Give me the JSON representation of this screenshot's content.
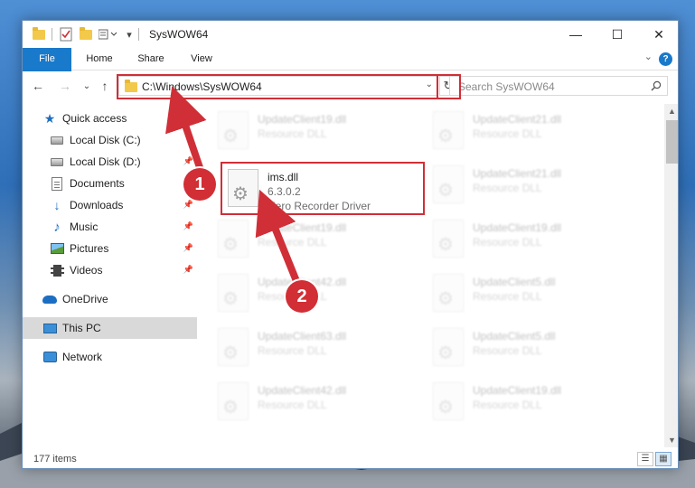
{
  "window": {
    "title": "SysWOW64",
    "minimize_glyph": "—",
    "maximize_glyph": "☐",
    "close_glyph": "✕"
  },
  "ribbon": {
    "tabs": [
      "File",
      "Home",
      "Share",
      "View"
    ],
    "help_glyph": "?",
    "collapse_glyph": "⌄"
  },
  "nav": {
    "back_glyph": "←",
    "forward_glyph": "→",
    "recent_glyph": "⌄",
    "up_glyph": "↑",
    "address": "C:\\Windows\\SysWOW64",
    "address_dropdown_glyph": "⌄",
    "refresh_glyph": "↻",
    "search_placeholder": "Search SysWOW64"
  },
  "sidebar": {
    "items": [
      {
        "label": "Quick access",
        "icon": "star-icon"
      },
      {
        "label": "Local Disk (C:)",
        "icon": "drive-icon"
      },
      {
        "label": "Local Disk (D:)",
        "icon": "drive-icon"
      },
      {
        "label": "Documents",
        "icon": "documents-icon"
      },
      {
        "label": "Downloads",
        "icon": "downloads-icon"
      },
      {
        "label": "Music",
        "icon": "music-icon"
      },
      {
        "label": "Pictures",
        "icon": "pictures-icon"
      },
      {
        "label": "Videos",
        "icon": "videos-icon"
      },
      {
        "label": "OneDrive",
        "icon": "onedrive-icon"
      },
      {
        "label": "This PC",
        "icon": "this-pc-icon",
        "selected": true
      },
      {
        "label": "Network",
        "icon": "network-icon"
      }
    ],
    "pin_glyph": "📌"
  },
  "files": {
    "left": [
      {
        "name": "UpdateClient19.dll",
        "type": "Resource DLL"
      },
      {
        "name": "ims.dll",
        "version": "6.3.0.2",
        "description": "Nero Recorder Driver"
      },
      {
        "name": "UpdateClient19.dll",
        "type": "Resource DLL"
      },
      {
        "name": "UpdateClient42.dll",
        "type": "Resource DLL"
      },
      {
        "name": "UpdateClient63.dll",
        "type": "Resource DLL"
      },
      {
        "name": "UpdateClient42.dll",
        "type": "Resource DLL"
      }
    ],
    "right": [
      {
        "name": "UpdateClient21.dll",
        "type": "Resource DLL"
      },
      {
        "name": "UpdateClient21.dll",
        "type": "Resource DLL"
      },
      {
        "name": "UpdateClient19.dll",
        "type": "Resource DLL"
      },
      {
        "name": "UpdateClient5.dll",
        "type": "Resource DLL"
      },
      {
        "name": "UpdateClient5.dll",
        "type": "Resource DLL"
      },
      {
        "name": "UpdateClient19.dll",
        "type": "Resource DLL"
      }
    ],
    "gear_glyph": "⚙"
  },
  "status": {
    "count": "177 items",
    "details_view_glyph": "☰",
    "large_icons_glyph": "▦"
  },
  "annotations": {
    "step1": "1",
    "step2": "2",
    "color": "#d02f37"
  }
}
